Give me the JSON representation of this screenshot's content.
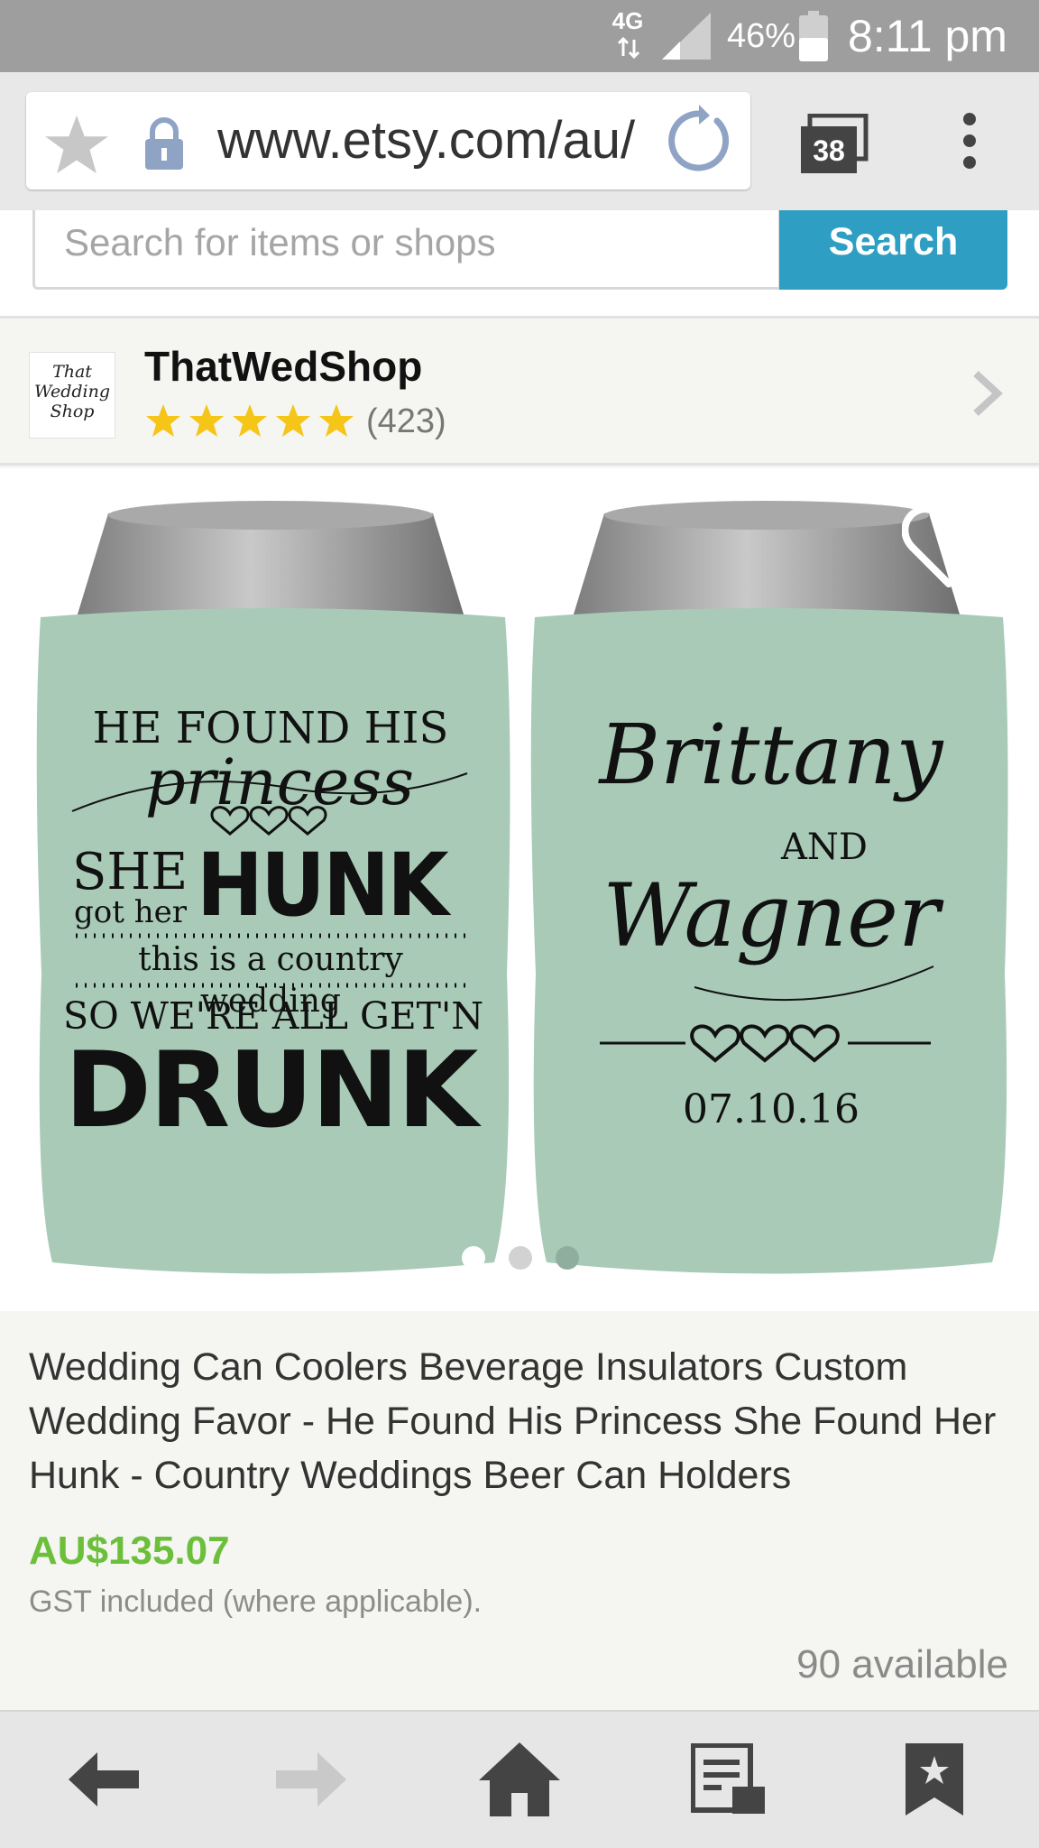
{
  "status_bar": {
    "network": "4G",
    "battery": "46%",
    "time": "8:11 pm"
  },
  "browser": {
    "url": "www.etsy.com/au/",
    "tab_count": "38"
  },
  "search": {
    "placeholder": "Search for items or shops",
    "button_label": "Search"
  },
  "shop": {
    "logo_text_lines": [
      "That",
      "Wedding",
      "Shop"
    ],
    "name": "ThatWedShop",
    "rating_stars": 5,
    "review_count": "(423)"
  },
  "product_image": {
    "left_can": {
      "line1": "HE FOUND HIS",
      "line2": "princess",
      "line3_a": "SHE",
      "line3_b": "got her",
      "line3_c": "HUNK",
      "line4": "this is a country wedding",
      "line5": "SO WE'RE ALL GET'N",
      "line6": "DRUNK"
    },
    "right_can": {
      "name1": "Brittany",
      "and": "AND",
      "name2": "Wagner",
      "date": "07.10.16"
    },
    "carousel_dots": 3,
    "active_dot": 0,
    "can_color": "#a8cab7"
  },
  "listing": {
    "title": "Wedding Can Coolers Beverage Insulators Custom Wedding Favor - He Found His Princess She Found Her Hunk - Country Weddings Beer Can Holders",
    "price": "AU$135.07",
    "price_color": "#6cbf3b",
    "tax_note": "GST included (where applicable).",
    "availability": "90 available"
  },
  "bottom_nav": {
    "items": [
      "back-icon",
      "forward-icon",
      "home-icon",
      "reader-icon",
      "bookmark-icon"
    ]
  }
}
